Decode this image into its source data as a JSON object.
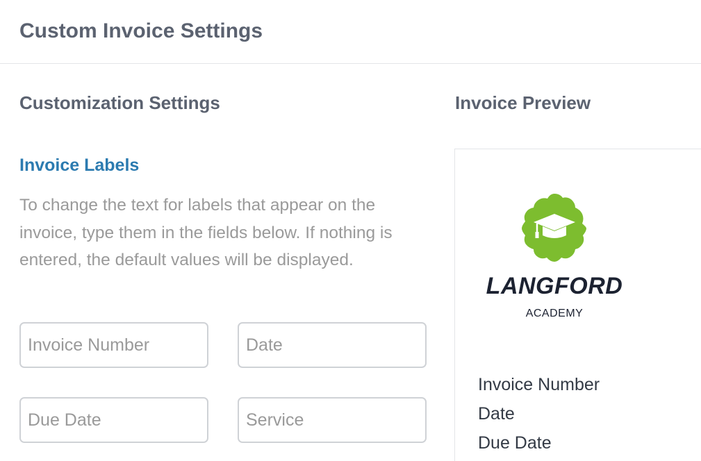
{
  "header": {
    "title": "Custom Invoice Settings"
  },
  "customization": {
    "title": "Customization Settings",
    "labels_heading": "Invoice Labels",
    "help_text": "To change the text for labels that appear on the invoice, type them in the fields below. If nothing is entered, the default values will be displayed.",
    "fields": [
      {
        "placeholder": "Invoice Number",
        "value": ""
      },
      {
        "placeholder": "Date",
        "value": ""
      },
      {
        "placeholder": "Due Date",
        "value": ""
      },
      {
        "placeholder": "Service",
        "value": ""
      }
    ]
  },
  "preview": {
    "title": "Invoice Preview",
    "logo": {
      "icon": "graduation-cap-icon",
      "badge_color": "#7dbd2f",
      "name": "LANGFORD",
      "subtitle": "ACADEMY"
    },
    "labels": [
      "Invoice Number",
      "Date",
      "Due Date"
    ]
  },
  "colors": {
    "heading": "#5b6270",
    "accent": "#2c7bb0",
    "muted_text": "#9a9a9a"
  }
}
